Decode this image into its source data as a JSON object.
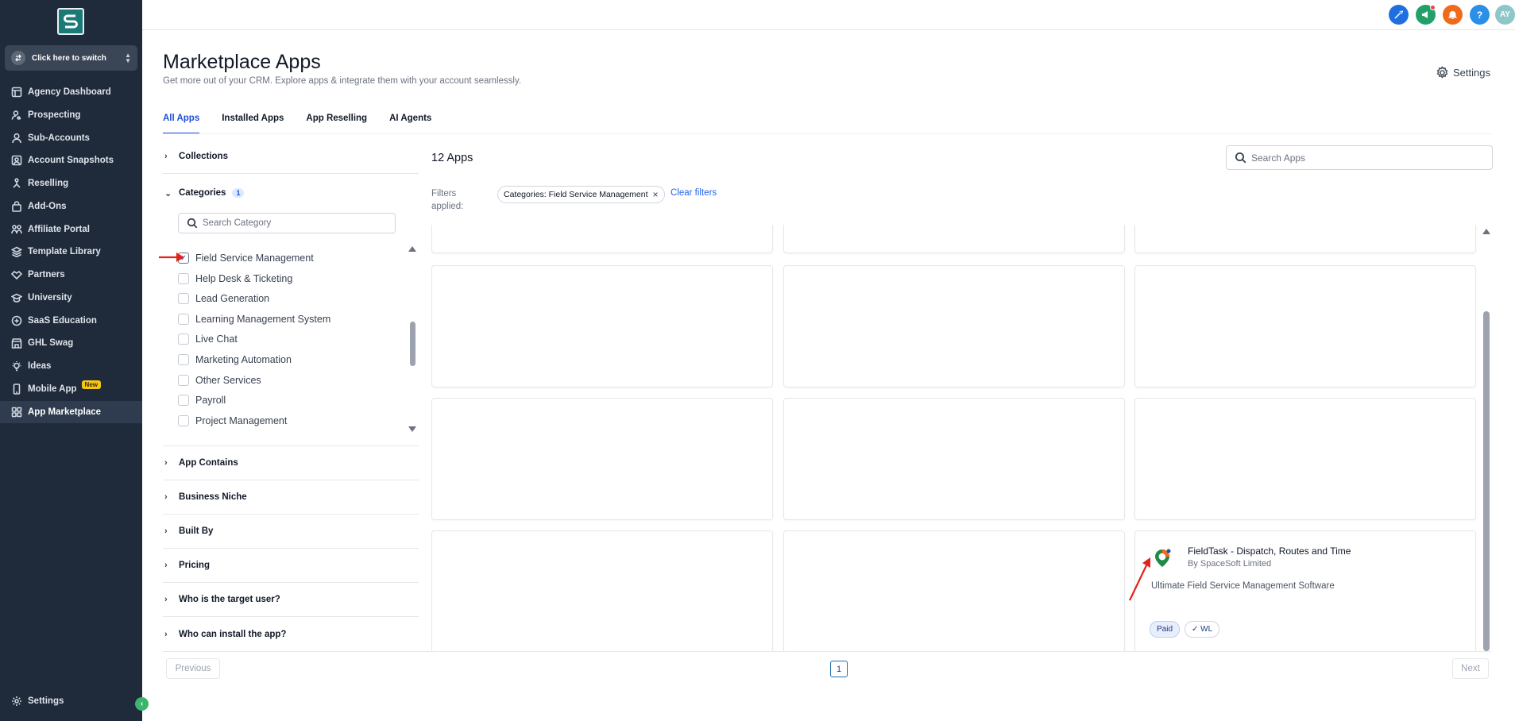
{
  "sidebar": {
    "switcher_label": "Click here to switch",
    "items": [
      {
        "label": "Agency Dashboard",
        "icon": "dashboard-icon"
      },
      {
        "label": "Prospecting",
        "icon": "prospecting-icon"
      },
      {
        "label": "Sub-Accounts",
        "icon": "user-icon"
      },
      {
        "label": "Account Snapshots",
        "icon": "snapshot-icon"
      },
      {
        "label": "Reselling",
        "icon": "reselling-icon"
      },
      {
        "label": "Add-Ons",
        "icon": "bag-icon"
      },
      {
        "label": "Affiliate Portal",
        "icon": "affiliate-icon"
      },
      {
        "label": "Template Library",
        "icon": "template-icon"
      },
      {
        "label": "Partners",
        "icon": "handshake-icon"
      },
      {
        "label": "University",
        "icon": "graduation-cap-icon"
      },
      {
        "label": "SaaS Education",
        "icon": "saas-icon"
      },
      {
        "label": "GHL Swag",
        "icon": "store-icon"
      },
      {
        "label": "Ideas",
        "icon": "lightbulb-icon"
      },
      {
        "label": "Mobile App",
        "icon": "mobile-icon",
        "badge": "New"
      },
      {
        "label": "App Marketplace",
        "icon": "grid-icon",
        "active": true
      }
    ],
    "settings_label": "Settings"
  },
  "topbar": {
    "avatar_initials": "AY",
    "help_label": "?",
    "colors": {
      "blue": "#1f6fe0",
      "green": "#23a06a",
      "orange": "#f06a1c",
      "help": "#2b8fe8",
      "avatar": "#8fc6c8"
    }
  },
  "header": {
    "title": "Marketplace Apps",
    "subtitle": "Get more out of your CRM. Explore apps & integrate them with your account seamlessly.",
    "settings_label": "Settings"
  },
  "tabs": [
    {
      "label": "All Apps",
      "active": true
    },
    {
      "label": "Installed Apps"
    },
    {
      "label": "App Reselling"
    },
    {
      "label": "AI Agents"
    }
  ],
  "filters": {
    "collections_label": "Collections",
    "categories_label": "Categories",
    "categories_count": "1",
    "category_search_placeholder": "Search Category",
    "categories": [
      {
        "label": "Field Service Management",
        "checked": true
      },
      {
        "label": "Help Desk & Ticketing",
        "checked": false
      },
      {
        "label": "Lead Generation",
        "checked": false
      },
      {
        "label": "Learning Management System",
        "checked": false
      },
      {
        "label": "Live Chat",
        "checked": false
      },
      {
        "label": "Marketing Automation",
        "checked": false
      },
      {
        "label": "Other Services",
        "checked": false
      },
      {
        "label": "Payroll",
        "checked": false
      },
      {
        "label": "Project Management",
        "checked": false
      }
    ],
    "groups": [
      {
        "label": "App Contains"
      },
      {
        "label": "Business Niche"
      },
      {
        "label": "Built By"
      },
      {
        "label": "Pricing"
      },
      {
        "label": "Who is the target user?"
      },
      {
        "label": "Who can install the app?"
      }
    ]
  },
  "apps": {
    "count_label": "12 Apps",
    "search_placeholder": "Search Apps",
    "filters_applied_label": "Filters applied:",
    "filter_chip": "Categories: Field Service Management",
    "clear_filters_label": "Clear filters",
    "featured": {
      "name": "FieldTask - Dispatch, Routes and Time",
      "developer": "By SpaceSoft Limited",
      "description": "Ultimate Field Service Management Software",
      "badges": [
        "Paid",
        "✓ WL"
      ]
    }
  },
  "pagination": {
    "previous_label": "Previous",
    "current_page": "1",
    "next_label": "Next"
  }
}
